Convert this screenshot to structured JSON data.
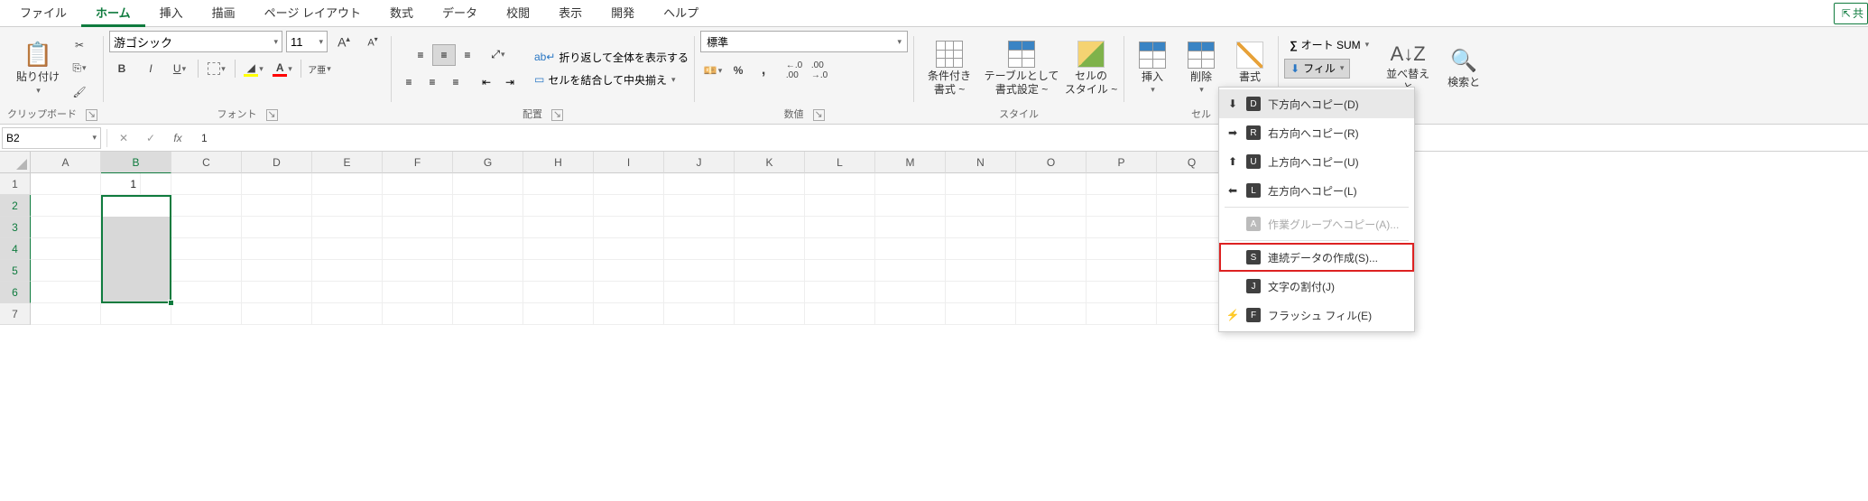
{
  "tabs": {
    "file": "ファイル",
    "home": "ホーム",
    "insert": "挿入",
    "draw": "描画",
    "page_layout": "ページ レイアウト",
    "formulas": "数式",
    "data": "データ",
    "review": "校閲",
    "view": "表示",
    "developer": "開発",
    "help": "ヘルプ"
  },
  "share_label": "共",
  "ribbon": {
    "clipboard": {
      "paste": "貼り付け",
      "label": "クリップボード"
    },
    "font": {
      "name": "游ゴシック",
      "size": "11",
      "label": "フォント",
      "bold": "B",
      "italic": "I",
      "underline": "U",
      "phonetic": "ア亜"
    },
    "alignment": {
      "wrap": "折り返して全体を表示する",
      "merge": "セルを結合して中央揃え",
      "label": "配置"
    },
    "number": {
      "format": "標準",
      "label": "数値"
    },
    "styles": {
      "cond_format_l1": "条件付き",
      "cond_format_l2": "書式 ~",
      "table_l1": "テーブルとして",
      "table_l2": "書式設定 ~",
      "cell_l1": "セルの",
      "cell_l2": "スタイル ~",
      "label": "スタイル"
    },
    "cells": {
      "insert": "挿入",
      "delete": "削除",
      "format": "書式",
      "label": "セル"
    },
    "editing": {
      "autosum": "オート SUM",
      "fill": "フィル",
      "sort_l1": "並べ替えと",
      "find_l1": "検索と"
    }
  },
  "formula_bar": {
    "name": "B2",
    "value": "1"
  },
  "grid": {
    "cols": [
      "A",
      "B",
      "C",
      "D",
      "E",
      "F",
      "G",
      "H",
      "I",
      "J",
      "K",
      "L",
      "M",
      "N",
      "O",
      "P",
      "Q"
    ],
    "rows": [
      "1",
      "2",
      "3",
      "4",
      "5",
      "6",
      "7"
    ],
    "b2_value": "1"
  },
  "fill_menu": {
    "down": "下方向へコピー(D)",
    "right": "右方向へコピー(R)",
    "up": "上方向へコピー(U)",
    "left": "左方向へコピー(L)",
    "group": "作業グループへコピー(A)...",
    "series": "連続データの作成(S)...",
    "justify": "文字の割付(J)",
    "flash": "フラッシュ フィル(E)"
  }
}
